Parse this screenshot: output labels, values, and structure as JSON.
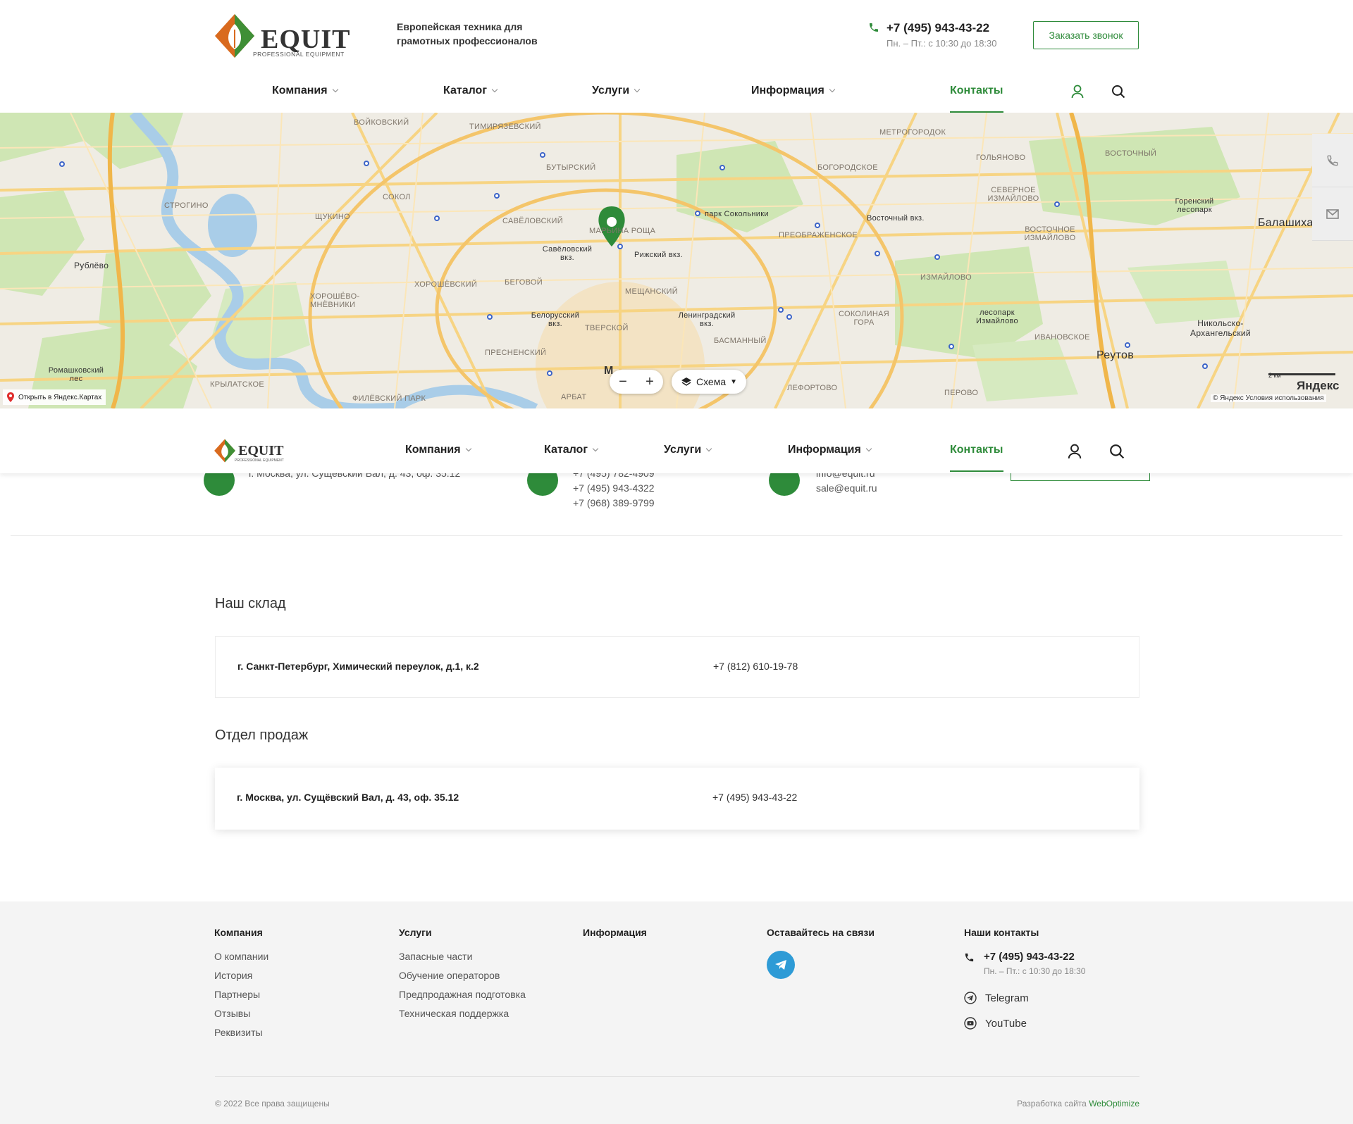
{
  "header": {
    "logo_text": "EQUIT",
    "logo_sub": "PROFESSIONAL EQUIPMENT",
    "tagline": "Европейская техника для грамотных профессионалов",
    "phone": "+7 (495) 943-43-22",
    "hours": "Пн. – Пт.: с 10:30 до 18:30",
    "callback_button": "Заказать звонок"
  },
  "nav": {
    "items": [
      {
        "label": "Компания"
      },
      {
        "label": "Каталог"
      },
      {
        "label": "Услуги"
      },
      {
        "label": "Информация"
      },
      {
        "label": "Контакты"
      }
    ]
  },
  "map": {
    "labels": [
      "ВОЙКОВСКИЙ",
      "ТИМИРЯЗЕВСКИЙ",
      "БУТЫРСКИЙ",
      "САВЁЛОВСКИЙ",
      "СОКОЛ",
      "ЩУКИНО",
      "СТРОГИНО",
      "ХОРОШЁВСКИЙ",
      "ХОРОШЁВО-МНЁВНИКИ",
      "БЕГОВОЙ",
      "ПРЕСНЕНСКИЙ",
      "ТВЕРСКОЙ",
      "МЕЩАНСКИЙ",
      "БАСМАННЫЙ",
      "ЛЕФОРТОВО",
      "АРБАТ",
      "КРЫЛАТСКОЕ",
      "ФИЛЁВСКИЙ ПАРК",
      "МЕТРОГОРОДОК",
      "ГОЛЬЯНОВО",
      "БОГОРОДСКОЕ",
      "ВОСТОЧНЫЙ",
      "СЕВЕРНОЕ ИЗМАЙЛОВО",
      "ВОСТОЧНОЕ ИЗМАЙЛОВО",
      "ПРЕОБРАЖЕНСКОЕ",
      "ИЗМАЙЛОВО",
      "СОКОЛИНАЯ ГОРА",
      "ИВАНОВСКОЕ",
      "ПЕРОВО",
      "МАРЬИНА РОЩА"
    ],
    "places": [
      "Рублёво",
      "Балашиха",
      "Реутов",
      "Никольско-Архангельский"
    ],
    "parks": [
      "парк Сокольники",
      "лесопарк Измайлово",
      "Горенский лесопарк",
      "Ромашковский лес"
    ],
    "stations": [
      "Савёловский вкз.",
      "Рижский вкз.",
      "Белорусский вкз.",
      "Ленинградский вкз.",
      "Восточный вкз."
    ],
    "open_link": "Открыть в Яндекс.Картах",
    "scheme_label": "Схема",
    "zoom_minus": "−",
    "zoom_plus": "+",
    "yandex_logo": "Яндекс",
    "copyright": "© Яндекс  Условия использования",
    "scale": "2 км",
    "partial_center_letter": "М"
  },
  "strip": {
    "address": "г. Москва, ул. Сущёвский Вал, д. 43, оф. 35.12",
    "phones": [
      "+7 (495) 782-4909",
      "+7 (495) 943-4322",
      "+7 (968) 389-9799"
    ],
    "emails": [
      "info@equit.ru",
      "sale@equit.ru"
    ]
  },
  "warehouse": {
    "title": "Наш склад",
    "address": "г. Санкт-Петербург, Химический переулок, д.1, к.2",
    "phone": "+7 (812) 610-19-78"
  },
  "sales": {
    "title": "Отдел продаж",
    "address": "г. Москва, ул. Сущёвский Вал, д. 43, оф. 35.12",
    "phone": "+7 (495) 943-43-22"
  },
  "footer": {
    "company": {
      "title": "Компания",
      "links": [
        "О компании",
        "История",
        "Партнеры",
        "Отзывы",
        "Реквизиты"
      ]
    },
    "services": {
      "title": "Услуги",
      "links": [
        "Запасные части",
        "Обучение операторов",
        "Предпродажная подготовка",
        "Техническая поддержка"
      ]
    },
    "info": {
      "title": "Информация"
    },
    "social": {
      "title": "Оставайтесь на связи"
    },
    "contacts": {
      "title": "Наши контакты",
      "phone": "+7 (495) 943-43-22",
      "hours": "Пн. – Пт.: с 10:30 до 18:30",
      "telegram": "Telegram",
      "youtube": "YouTube"
    },
    "copyright": "© 2022 Все права защищены",
    "dev_prefix": "Разработка сайта",
    "dev_name": "WebOptimize"
  },
  "colors": {
    "accent": "#2e8b3a",
    "telegram": "#2e9bd6",
    "footer_bg": "#f4f4f4"
  }
}
